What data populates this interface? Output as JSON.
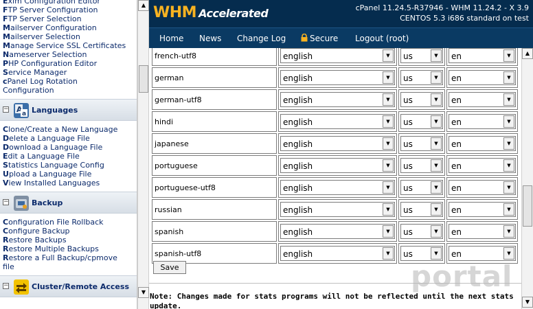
{
  "sidebar": {
    "top_links": [
      {
        "first": "E",
        "rest": "xim Configuration Editor"
      },
      {
        "first": "F",
        "rest": "TP Server Configuration"
      },
      {
        "first": "F",
        "rest": "TP Server Selection"
      },
      {
        "first": "M",
        "rest": "ailserver Configuration"
      },
      {
        "first": "M",
        "rest": "ailserver Selection"
      },
      {
        "first": "M",
        "rest": "anage Service SSL Certificates"
      },
      {
        "first": "N",
        "rest": "ameserver Selection"
      },
      {
        "first": "P",
        "rest": "HP Configuration Editor"
      },
      {
        "first": "S",
        "rest": "ervice Manager"
      },
      {
        "first": "c",
        "rest": "Panel Log Rotation"
      },
      {
        "first": "",
        "rest": "Configuration"
      }
    ],
    "languages": {
      "title": "Languages",
      "links": [
        {
          "first": "C",
          "rest": "lone/Create a New Language"
        },
        {
          "first": "D",
          "rest": "elete a Language File"
        },
        {
          "first": "D",
          "rest": "ownload a Language File"
        },
        {
          "first": "E",
          "rest": "dit a Language File"
        },
        {
          "first": "S",
          "rest": "tatistics Language Config"
        },
        {
          "first": "U",
          "rest": "pload a Language File"
        },
        {
          "first": "V",
          "rest": "iew Installed Languages"
        }
      ]
    },
    "backup": {
      "title": "Backup",
      "links": [
        {
          "first": "C",
          "rest": "onfiguration File Rollback"
        },
        {
          "first": "C",
          "rest": "onfigure Backup"
        },
        {
          "first": "R",
          "rest": "estore Backups"
        },
        {
          "first": "R",
          "rest": "estore Multiple Backups"
        },
        {
          "first": "R",
          "rest": "estore a Full Backup/cpmove"
        },
        {
          "first": "",
          "rest": "file"
        }
      ]
    },
    "cluster": {
      "title": "Cluster/Remote Access"
    }
  },
  "header": {
    "logo_main": "WHM",
    "logo_sub": "Accelerated",
    "version_line1": "cPanel 11.24.5-R37946 - WHM 11.24.2 - X 3.9",
    "version_line2": "CENTOS 5.3 i686 standard on test"
  },
  "nav": {
    "items": [
      "Home",
      "News",
      "Change Log",
      "Secure",
      "Logout (root)"
    ]
  },
  "table": {
    "rows": [
      {
        "name": "french-utf8",
        "lang": "english",
        "cc": "us",
        "code": "en"
      },
      {
        "name": "german",
        "lang": "english",
        "cc": "us",
        "code": "en"
      },
      {
        "name": "german-utf8",
        "lang": "english",
        "cc": "us",
        "code": "en"
      },
      {
        "name": "hindi",
        "lang": "english",
        "cc": "us",
        "code": "en"
      },
      {
        "name": "japanese",
        "lang": "english",
        "cc": "us",
        "code": "en"
      },
      {
        "name": "portuguese",
        "lang": "english",
        "cc": "us",
        "code": "en"
      },
      {
        "name": "portuguese-utf8",
        "lang": "english",
        "cc": "us",
        "code": "en"
      },
      {
        "name": "russian",
        "lang": "english",
        "cc": "us",
        "code": "en"
      },
      {
        "name": "spanish",
        "lang": "english",
        "cc": "us",
        "code": "en"
      },
      {
        "name": "spanish-utf8",
        "lang": "english",
        "cc": "us",
        "code": "en"
      }
    ]
  },
  "save_label": "Save",
  "note": "Note: Changes made for stats programs will not be reflected until the next stats update.",
  "watermark": "portal",
  "colors": {
    "header_bg": "#052c4e",
    "nav_bg": "#0a3a63",
    "logo": "#f7b221",
    "link": "#0b2a6b"
  }
}
